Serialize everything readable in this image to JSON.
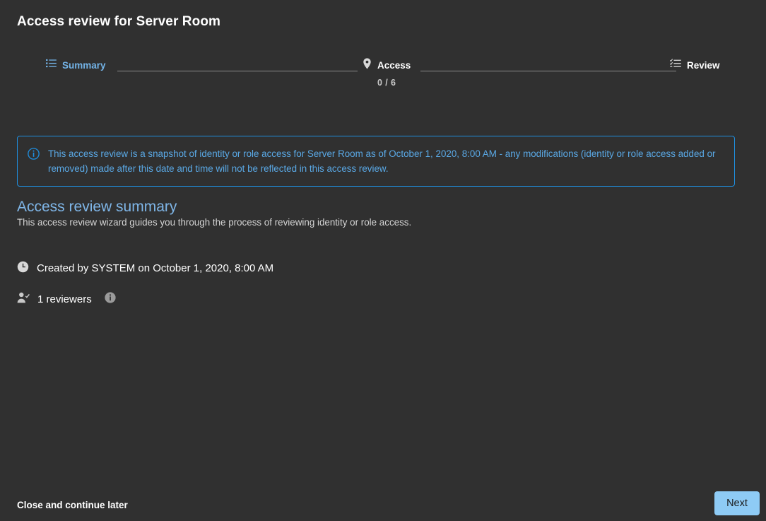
{
  "page": {
    "title": "Access review for Server Room"
  },
  "stepper": {
    "steps": [
      {
        "label": "Summary",
        "icon": "list-icon",
        "state": "active",
        "sub": ""
      },
      {
        "label": "Access",
        "icon": "location-pin-icon",
        "state": "current",
        "sub": "0 / 6"
      },
      {
        "label": "Review",
        "icon": "checklist-icon",
        "state": "upcoming",
        "sub": ""
      }
    ]
  },
  "banner": {
    "icon": "info-circle-icon",
    "text": "This access review is a snapshot of identity or role access for Server Room as of October 1, 2020, 8:00 AM - any modifications (identity or role access added or removed) made after this date and time will not be reflected in this access review."
  },
  "summary": {
    "heading": "Access review summary",
    "description": "This access review wizard guides you through the process of reviewing identity or role access."
  },
  "meta": {
    "created": {
      "icon": "clock-icon",
      "text": "Created by SYSTEM on October 1, 2020, 8:00 AM"
    },
    "reviewers": {
      "icon": "person-check-icon",
      "text": "1 reviewers",
      "badge": "info-badge-icon"
    }
  },
  "footer": {
    "close_label": "Close and continue later",
    "next_label": "Next"
  },
  "colors": {
    "background": "#303030",
    "accent_blue": "#5aa9e6",
    "banner_border": "#1f8fe0",
    "heading_blue": "#7fb6e8",
    "next_button": "#8ecbf5",
    "connector": "#8a8a8a"
  }
}
